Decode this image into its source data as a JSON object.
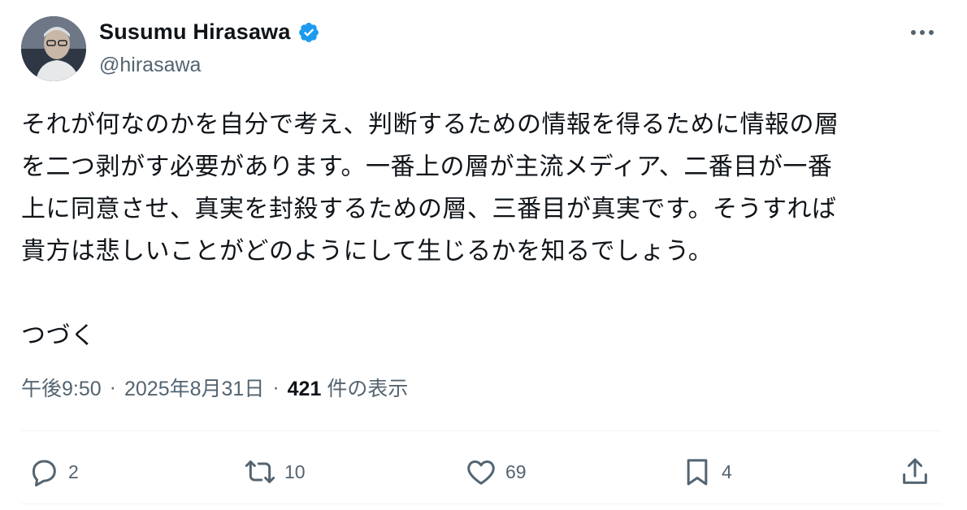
{
  "author": {
    "display_name": "Susumu Hirasawa",
    "handle": "@hirasawa",
    "verified_icon": "verified-badge-icon",
    "badge_color": "#1d9bf0"
  },
  "tweet": {
    "lines": [
      "それが何なのかを自分で考え、判断するための情報を得るために情報の層",
      "を二つ剥がす必要があります。一番上の層が主流メディア、二番目が一番",
      "上に同意させ、真実を封殺するための層、三番目が真実です。そうすれば",
      "貴方は悲しいことがどのようにして生じるかを知るでしょう。",
      "つづく"
    ]
  },
  "meta": {
    "time": "午後9:50",
    "separator": "·",
    "date": "2025年8月31日",
    "views_count": "421",
    "views_label": "件の表示"
  },
  "actions": {
    "reply_count": "2",
    "retweet_count": "10",
    "like_count": "69",
    "bookmark_count": "4"
  },
  "colors": {
    "text": "#0f1419",
    "secondary": "#536471",
    "divider": "#eff3f4"
  }
}
